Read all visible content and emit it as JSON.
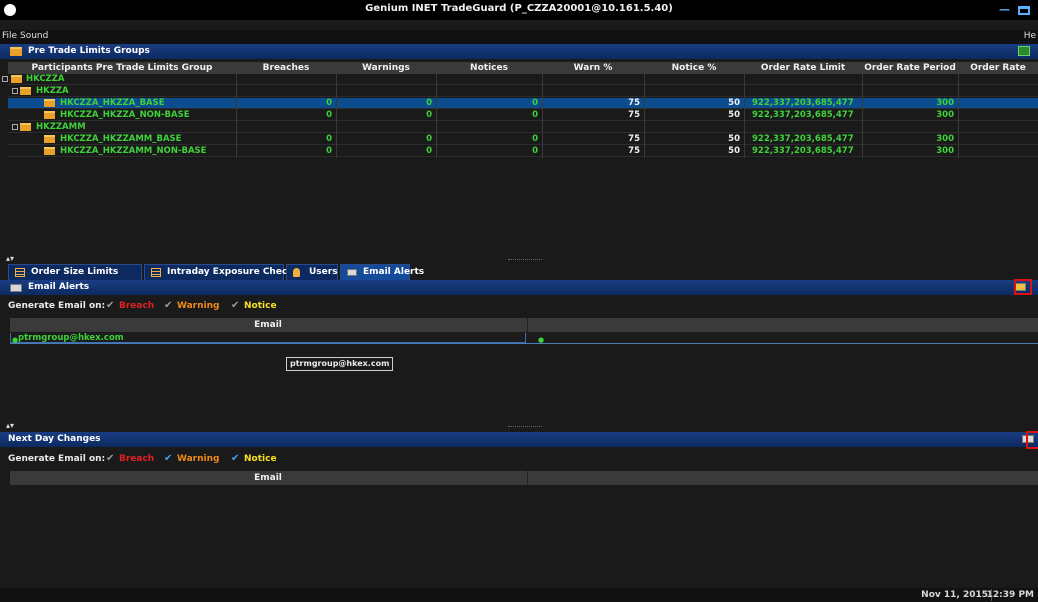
{
  "window": {
    "title": "Genium INET TradeGuard (P_CZZA20001@10.161.5.40)",
    "right_menu": "He"
  },
  "menu": {
    "items": [
      "File",
      "Sound"
    ]
  },
  "limits_section": {
    "title": "Pre Trade Limits Groups"
  },
  "limits_grid": {
    "columns": [
      "Participants Pre Trade Limits Group",
      "Breaches",
      "Warnings",
      "Notices",
      "Warn %",
      "Notice %",
      "Order Rate Limit",
      "Order Rate Period",
      "Order Rate"
    ],
    "rows": [
      {
        "name": "HKCZZA",
        "level": 0,
        "values": [
          "",
          "",
          "",
          "",
          "",
          "",
          "",
          ""
        ]
      },
      {
        "name": "HKZZA",
        "level": 1,
        "values": [
          "",
          "",
          "",
          "",
          "",
          "",
          "",
          ""
        ]
      },
      {
        "name": "HKCZZA_HKZZA_BASE",
        "level": 2,
        "selected": true,
        "values": [
          "0",
          "0",
          "0",
          "75",
          "50",
          "922,337,203,685,477",
          "300",
          ""
        ]
      },
      {
        "name": "HKCZZA_HKZZA_NON-BASE",
        "level": 2,
        "values": [
          "0",
          "0",
          "0",
          "75",
          "50",
          "922,337,203,685,477",
          "300",
          ""
        ]
      },
      {
        "name": "HKZZAMM",
        "level": 1,
        "values": [
          "",
          "",
          "",
          "",
          "",
          "",
          "",
          ""
        ]
      },
      {
        "name": "HKCZZA_HKZZAMM_BASE",
        "level": 2,
        "values": [
          "0",
          "0",
          "0",
          "75",
          "50",
          "922,337,203,685,477",
          "300",
          ""
        ]
      },
      {
        "name": "HKCZZA_HKZZAMM_NON-BASE",
        "level": 2,
        "values": [
          "0",
          "0",
          "0",
          "75",
          "50",
          "922,337,203,685,477",
          "300",
          ""
        ]
      }
    ]
  },
  "tabs": [
    {
      "label": "Order Size Limits",
      "icon": "grid-icon"
    },
    {
      "label": "Intraday Exposure Check",
      "icon": "grid-icon"
    },
    {
      "label": "Users",
      "icon": "user-icon"
    },
    {
      "label": "Email Alerts",
      "icon": "mail-icon",
      "active": true
    }
  ],
  "email_alerts": {
    "title": "Email Alerts",
    "generate_label": "Generate Email on:",
    "options": [
      {
        "label": "Breach",
        "color": "#e02020",
        "checked": false
      },
      {
        "label": "Warning",
        "color": "#f08a1a",
        "checked": false
      },
      {
        "label": "Notice",
        "color": "#f5e020",
        "checked": false
      }
    ],
    "column": "Email",
    "rows": [
      {
        "email": "ptrmgroup@hkex.com"
      }
    ],
    "tooltip": "ptrmgroup@hkex.com"
  },
  "next_day": {
    "title": "Next Day Changes",
    "generate_label": "Generate Email on:",
    "options": [
      {
        "label": "Breach",
        "color": "#e02020",
        "checked": false
      },
      {
        "label": "Warning",
        "color": "#f08a1a",
        "checked": true
      },
      {
        "label": "Notice",
        "color": "#f5e020",
        "checked": true
      }
    ],
    "column": "Email"
  },
  "status": {
    "date": "Nov 11, 2015",
    "time": "12:39 PM"
  }
}
